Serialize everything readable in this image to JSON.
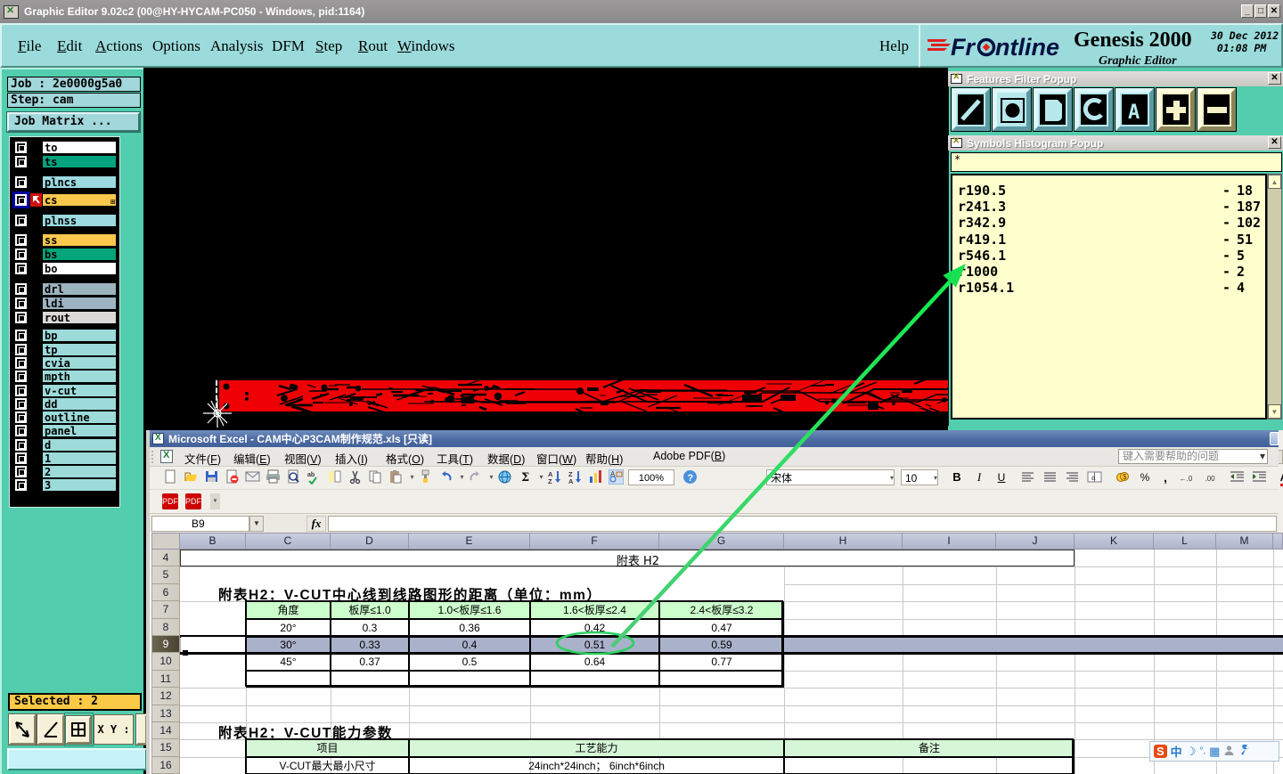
{
  "ge": {
    "title": "Graphic Editor 9.02c2 (00@HY-HYCAM-PC050 - Windows, pid:1164)",
    "menus": [
      {
        "label": "File",
        "u": 0
      },
      {
        "label": "Edit",
        "u": 0
      },
      {
        "label": "Actions",
        "u": 0
      },
      {
        "label": "Options",
        "u": -1
      },
      {
        "label": "Analysis",
        "u": -1
      },
      {
        "label": "DFM",
        "u": -1
      },
      {
        "label": "Step",
        "u": 0
      },
      {
        "label": "Rout",
        "u": 0
      },
      {
        "label": "Windows",
        "u": 0
      }
    ],
    "help_label": "Help",
    "brand": {
      "logo_text": "Frontline",
      "product": "Genesis 2000",
      "date": "30 Dec 2012",
      "time": "01:08 PM",
      "subtitle": "Graphic Editor"
    },
    "job_label": "Job : 2e0000g5a0",
    "step_label": "Step: cam",
    "job_matrix_label": "Job Matrix ...",
    "layers": [
      {
        "name": "to",
        "color": "#ffffff"
      },
      {
        "name": "ts",
        "color": "#02a47d"
      },
      {
        "name": "plncs",
        "color": "#9bdae1"
      },
      {
        "name": "cs",
        "color": "#fac84d",
        "selected": true
      },
      {
        "name": "plnss",
        "color": "#9bdae1"
      },
      {
        "name": "ss",
        "color": "#fac84d"
      },
      {
        "name": "bs",
        "color": "#00a57a"
      },
      {
        "name": "bo",
        "color": "#ffffff"
      },
      {
        "name": "drl",
        "color": "#9cb4be"
      },
      {
        "name": "ldi",
        "color": "#9cb3c1"
      },
      {
        "name": "rout",
        "color": "#dad9d7"
      },
      {
        "name": "bp",
        "color": "#9ddbda"
      },
      {
        "name": "tp",
        "color": "#9ddbda"
      },
      {
        "name": "cvia",
        "color": "#9ddbda"
      },
      {
        "name": "mpth",
        "color": "#9ddbda"
      },
      {
        "name": "v-cut",
        "color": "#9ddbda"
      },
      {
        "name": "dd",
        "color": "#9ddbda"
      },
      {
        "name": "outline",
        "color": "#9ddbda"
      },
      {
        "name": "panel",
        "color": "#9ddbda"
      },
      {
        "name": "d",
        "color": "#9ddbda"
      },
      {
        "name": "1",
        "color": "#9ddbda"
      },
      {
        "name": "2",
        "color": "#9ddbda"
      },
      {
        "name": "3",
        "color": "#9ddbda"
      }
    ],
    "selected_label": "Selected : 2",
    "xy_label": "X Y :"
  },
  "filter_popup": {
    "title": "Features Filter Popup",
    "buttons": [
      "line",
      "pad",
      "surface",
      "arc",
      "text",
      "plus",
      "minus"
    ]
  },
  "histogram_popup": {
    "title": "Symbols Histogram Popup",
    "filter_value": "*",
    "rows": [
      {
        "symbol": "r190.5",
        "count": "18"
      },
      {
        "symbol": "r241.3",
        "count": "187"
      },
      {
        "symbol": "r342.9",
        "count": "102"
      },
      {
        "symbol": "r419.1",
        "count": "51"
      },
      {
        "symbol": "r546.1",
        "count": "5"
      },
      {
        "symbol": "r1000",
        "count": "2"
      },
      {
        "symbol": "r1054.1",
        "count": "4"
      }
    ]
  },
  "excel": {
    "title": "Microsoft Excel - CAM中心P3CAM制作规范.xls [只读]",
    "menus": [
      "文件(F)",
      "编辑(E)",
      "视图(V)",
      "插入(I)",
      "格式(O)",
      "工具(T)",
      "数据(D)",
      "窗口(W)",
      "帮助(H)",
      "Adobe PDF(B)"
    ],
    "help_box_placeholder": "键入需要帮助的问题",
    "font_name": "宋体",
    "font_size": "10",
    "zoom_value": "100%",
    "name_box": "B9",
    "fx_label": "fx",
    "columns": [
      "B",
      "C",
      "D",
      "E",
      "F",
      "G",
      "H",
      "I",
      "J",
      "K",
      "L",
      "M"
    ],
    "rows": [
      "4",
      "5",
      "6",
      "7",
      "8",
      "9",
      "10",
      "11",
      "12",
      "13",
      "14",
      "15",
      "16"
    ],
    "sheet": {
      "h2_link": "附表 H2",
      "table1_title": "附表H2：V-CUT中心线到线路图形的距离（单位：mm）",
      "table1_headers": [
        "角度",
        "板厚≤1.0",
        "1.0<板厚≤1.6",
        "1.6<板厚≤2.4",
        "2.4<板厚≤3.2"
      ],
      "table1_rows": [
        [
          "20°",
          "0.3",
          "0.36",
          "0.42",
          "0.47"
        ],
        [
          "30°",
          "0.33",
          "0.4",
          "0.51",
          "0.59"
        ],
        [
          "45°",
          "0.37",
          "0.5",
          "0.64",
          "0.77"
        ]
      ],
      "table2_title": "附表H2：V-CUT能力参数",
      "table2_headers": [
        "项目",
        "工艺能力",
        "备注"
      ],
      "table2_rows": [
        [
          "V-CUT最大最小尺寸",
          "24inch*24inch； 6inch*6inch",
          ""
        ]
      ]
    }
  },
  "ime": {
    "mode": "中"
  }
}
